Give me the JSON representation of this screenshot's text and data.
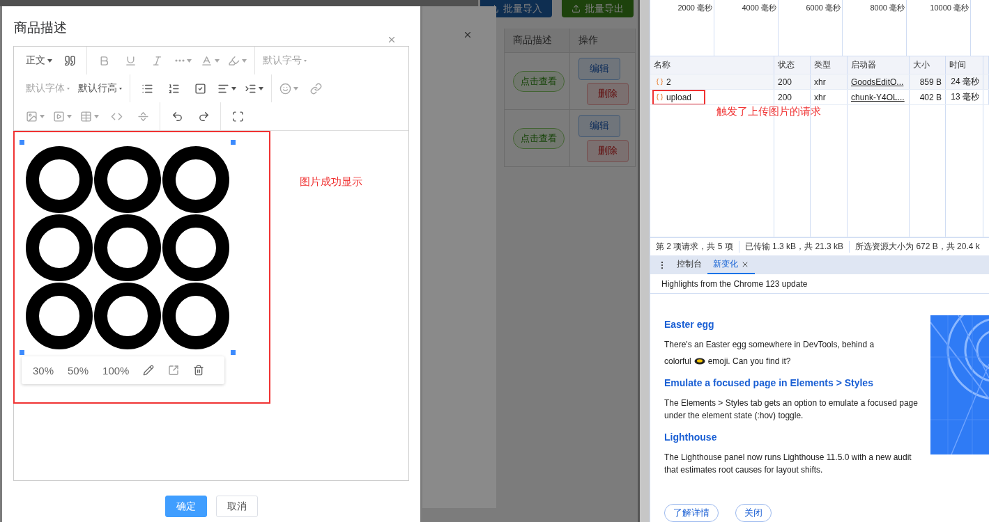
{
  "background_page": {
    "buttons": [
      {
        "label": "批量导入",
        "kind": "import"
      },
      {
        "label": "批量导出",
        "kind": "export"
      }
    ],
    "table": {
      "columns": [
        "商品描述",
        "操作"
      ],
      "rows": [
        {
          "description": "点击查看",
          "actions": [
            "编辑",
            "删除"
          ]
        },
        {
          "description": "点击查看",
          "actions": [
            "编辑",
            "删除"
          ]
        }
      ]
    }
  },
  "dialog": {
    "title": "商品描述",
    "toolbar_rows": [
      [
        [
          {
            "kind": "select",
            "label": "正文",
            "disabled": false
          },
          {
            "kind": "button",
            "disabled": false
          }
        ],
        [
          {
            "kind": "button",
            "disabled": true
          },
          {
            "kind": "button",
            "disabled": true
          },
          {
            "kind": "button",
            "disabled": true
          },
          {
            "kind": "button",
            "disabled": true,
            "dropdown": true
          },
          {
            "kind": "button",
            "disabled": true,
            "dropdown": true
          },
          {
            "kind": "button",
            "disabled": true,
            "dropdown": true
          }
        ],
        [
          {
            "kind": "select",
            "label": "默认字号",
            "disabled": true
          }
        ]
      ],
      [
        [
          {
            "kind": "select",
            "label": "默认字体",
            "disabled": true
          },
          {
            "kind": "select",
            "label": "默认行高",
            "disabled": false
          }
        ],
        [
          {
            "kind": "button",
            "disabled": false
          },
          {
            "kind": "button",
            "disabled": false
          },
          {
            "kind": "button",
            "disabled": false
          },
          {
            "kind": "button",
            "disabled": false,
            "dropdown": true
          },
          {
            "kind": "button",
            "disabled": false,
            "dropdown": true
          }
        ],
        [
          {
            "kind": "button",
            "disabled": true,
            "dropdown": true
          },
          {
            "kind": "button",
            "disabled": true
          }
        ]
      ],
      [
        [
          {
            "kind": "button",
            "disabled": true,
            "dropdown": true
          },
          {
            "kind": "button",
            "disabled": true,
            "dropdown": true
          },
          {
            "kind": "button",
            "disabled": true,
            "dropdown": true
          },
          {
            "kind": "button",
            "disabled": true
          },
          {
            "kind": "button",
            "disabled": true
          }
        ],
        [
          {
            "kind": "button",
            "disabled": false
          },
          {
            "kind": "button",
            "disabled": false
          }
        ],
        [
          {
            "kind": "button",
            "disabled": false
          }
        ]
      ]
    ],
    "image_toolbar": [
      "30%",
      "50%",
      "100%"
    ],
    "annotation": "图片成功显示",
    "buttons": [
      {
        "label": "确定",
        "kind": "primary"
      },
      {
        "label": "取消",
        "kind": "default"
      }
    ]
  },
  "devtools": {
    "timeline_ticks": [
      "2000 毫秒",
      "4000 毫秒",
      "6000 毫秒",
      "8000 毫秒",
      "10000 毫秒"
    ],
    "columns": [
      "名称",
      "状态",
      "类型",
      "启动器",
      "大小",
      "时间"
    ],
    "requests": [
      {
        "name": "2",
        "status": "200",
        "type": "xhr",
        "initiator": "GoodsEditO...",
        "size": "859 B",
        "time": "24 毫秒",
        "highlighted": false
      },
      {
        "name": "upload",
        "status": "200",
        "type": "xhr",
        "initiator": "chunk-Y4OL...",
        "size": "402 B",
        "time": "13 毫秒",
        "highlighted": true
      }
    ],
    "annotation": "触发了上传图片的请求",
    "summary": [
      "第 2 项请求，共 5 项",
      "已传输 1.3 kB，共 21.3 kB",
      "所选资源大小为 672 B，共 20.4 k"
    ],
    "drawer_tabs": [
      {
        "label": "控制台",
        "selected": false,
        "closable": false
      },
      {
        "label": "新变化",
        "selected": true,
        "closable": true
      }
    ],
    "whats_new": {
      "header": "Highlights from the Chrome 123 update",
      "sections": [
        {
          "title": "Easter egg",
          "text": "There's an Easter egg somewhere in DevTools, behind a",
          "text_2": "colorful",
          "text_after": "emoji. Can you find it?"
        },
        {
          "title": "Emulate a focused page in Elements > Styles",
          "text": "The Elements > Styles tab gets an option to emulate a focused page under the element state (:hov) toggle."
        },
        {
          "title": "Lighthouse",
          "text": "The Lighthouse panel now runs Lighthouse 11.5.0 with a new audit that estimates root causes for layout shifts."
        }
      ],
      "buttons": [
        "了解详情",
        "关闭"
      ]
    }
  }
}
